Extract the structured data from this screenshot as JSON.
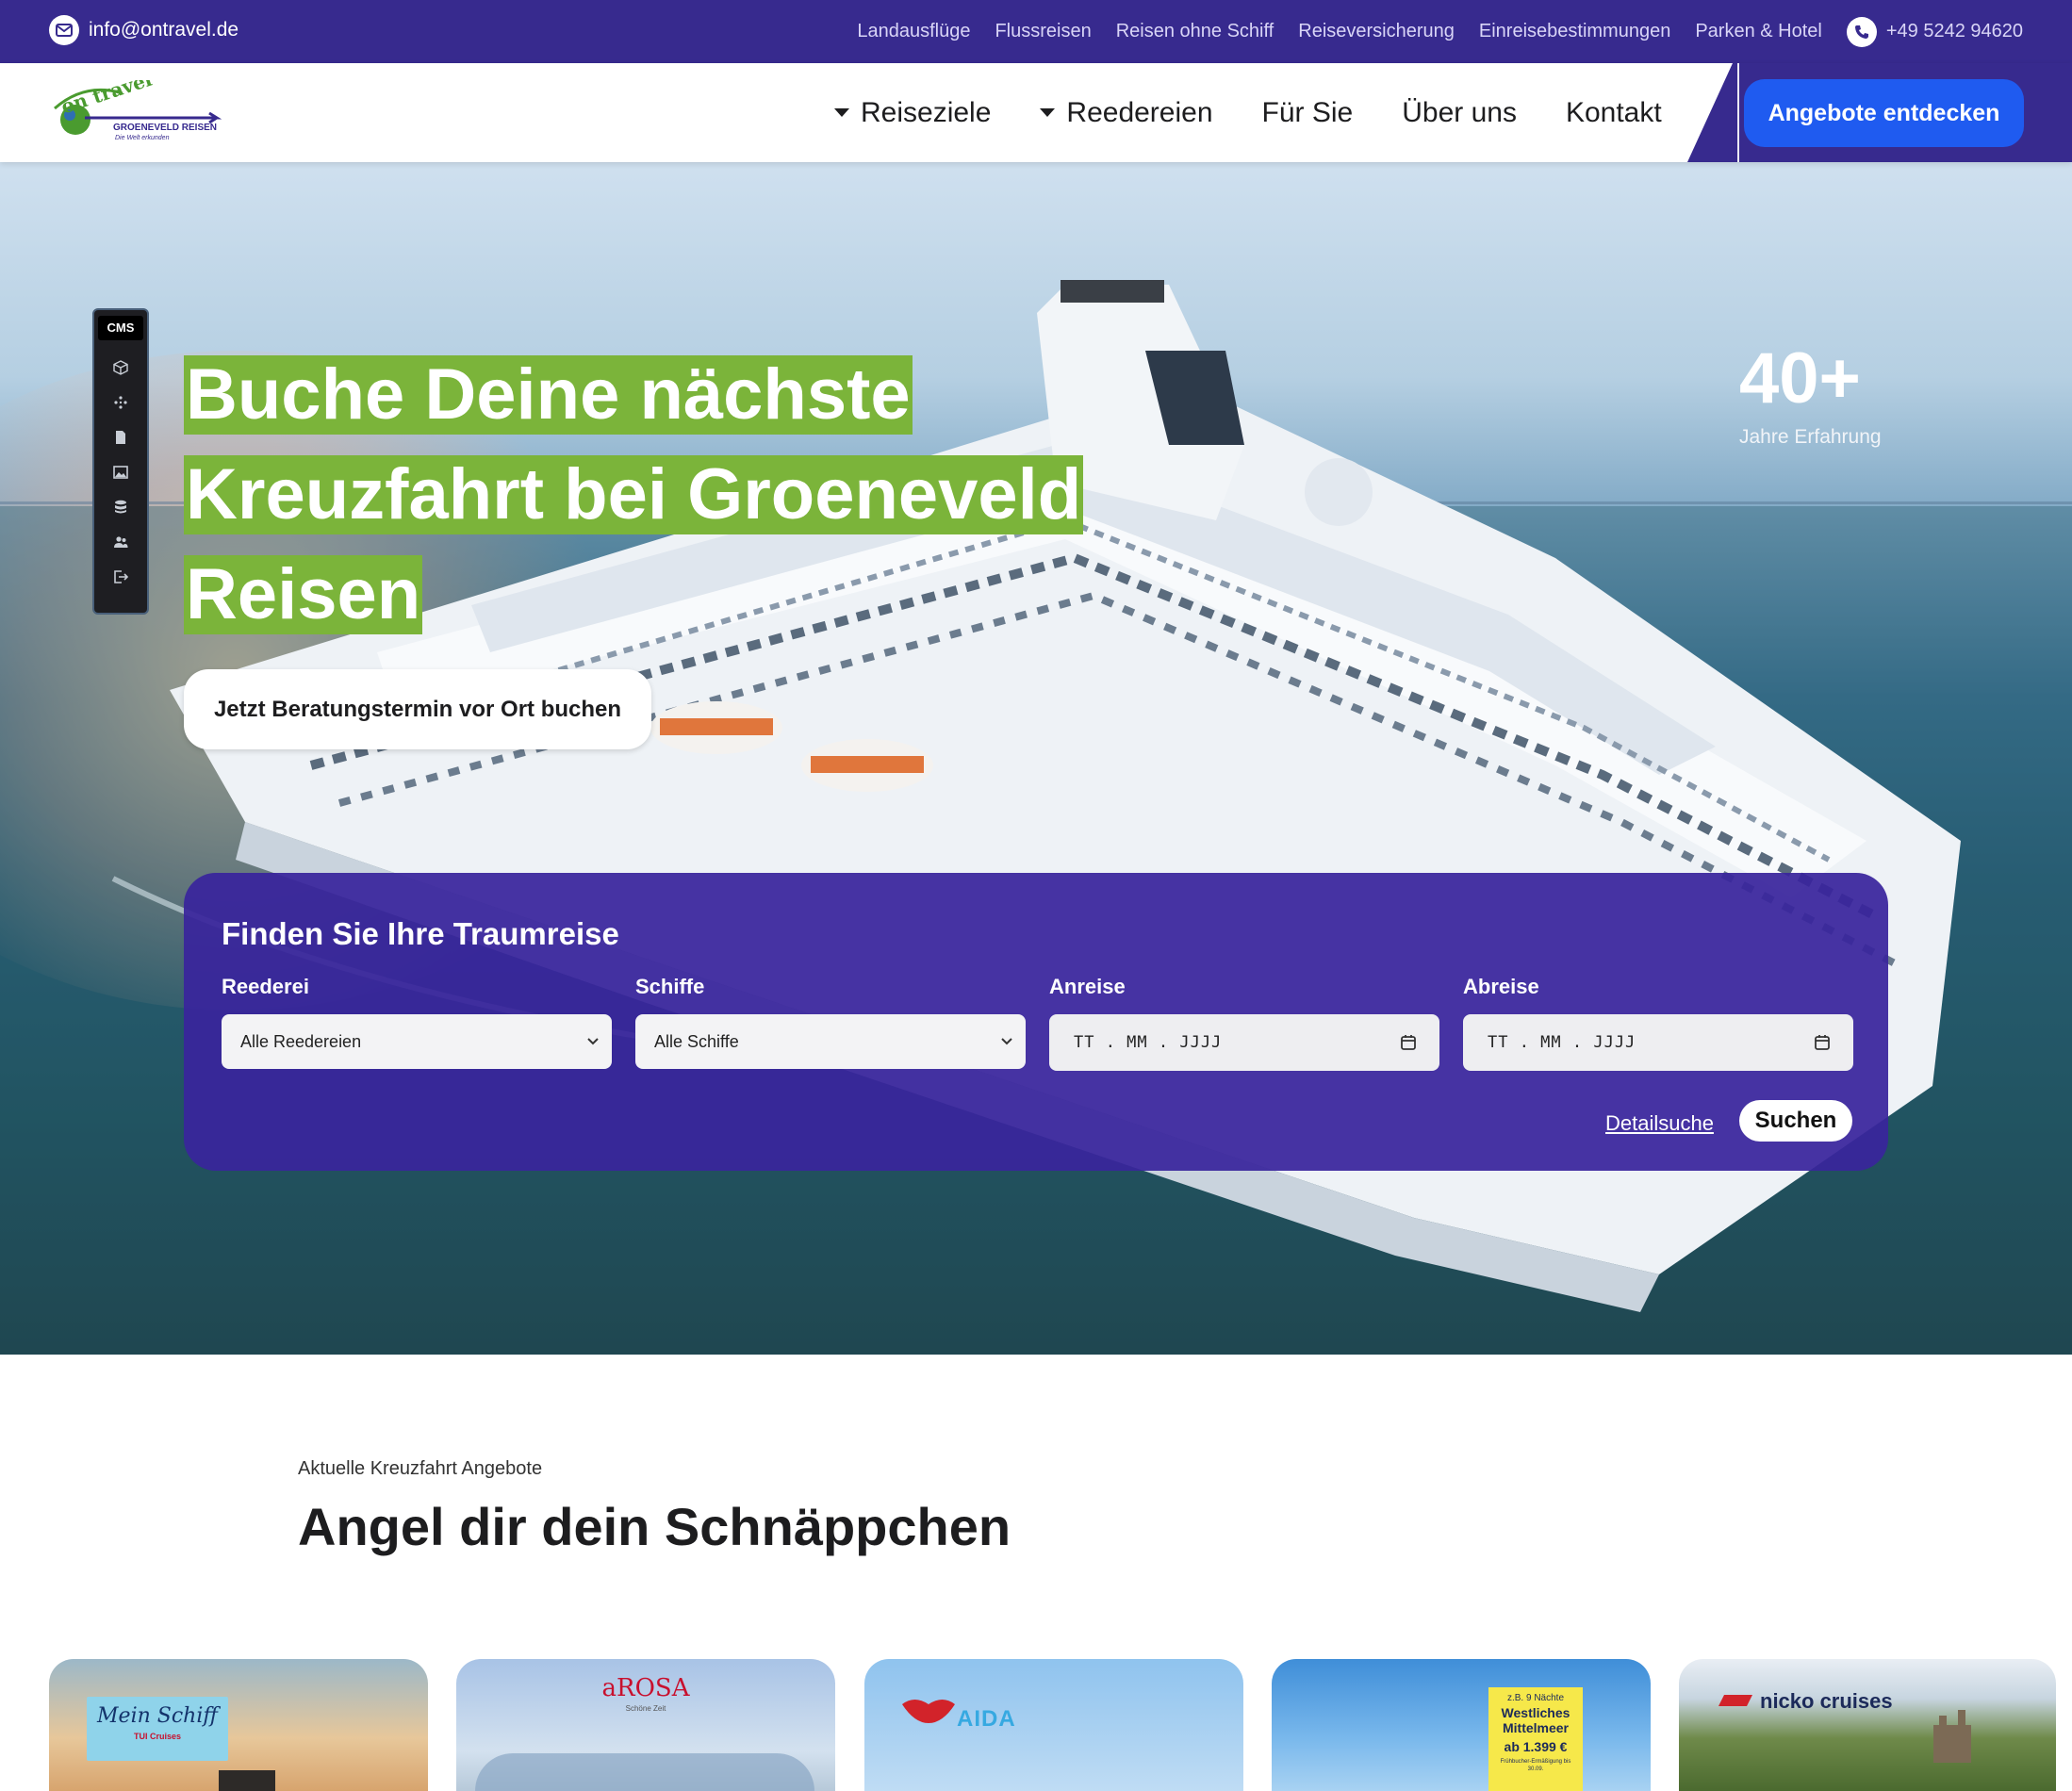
{
  "topbar": {
    "email": "info@ontravel.de",
    "links": [
      "Landausflüge",
      "Flussreisen",
      "Reisen ohne Schiff",
      "Reiseversicherung",
      "Einreisebestimmungen",
      "Parken & Hotel"
    ],
    "phone": "+49 5242 94620"
  },
  "logo": {
    "script_text": "on travel",
    "company": "GROENEVELD REISEN",
    "tagline": "Die Welt erkunden"
  },
  "nav": {
    "items": [
      "Reiseziele",
      "Reedereien",
      "Für Sie",
      "Über uns",
      "Kontakt"
    ],
    "cta": "Angebote entdecken"
  },
  "cms": {
    "label": "CMS",
    "icons": [
      "cube-icon",
      "sparkle-icon",
      "page-icon",
      "image-icon",
      "database-icon",
      "users-icon",
      "logout-icon"
    ]
  },
  "hero": {
    "headline_lines": [
      "Buche Deine nächste",
      "Kreuzfahrt bei Groeneveld",
      "Reisen"
    ],
    "button": "Jetzt Beratungstermin vor Ort buchen",
    "stat_number": "40+",
    "stat_label": "Jahre Erfahrung"
  },
  "finder": {
    "title": "Finden Sie Ihre Traumreise",
    "fields": [
      {
        "label": "Reederei",
        "value": "Alle Reedereien"
      },
      {
        "label": "Schiffe",
        "value": "Alle Schiffe"
      },
      {
        "label": "Anreise",
        "placeholder": "TT . MM . JJJJ"
      },
      {
        "label": "Abreise",
        "placeholder": "TT . MM . JJJJ"
      }
    ],
    "detail_link": "Detailsuche",
    "search_button": "Suchen"
  },
  "offers": {
    "kicker": "Aktuelle Kreuzfahrt Angebote",
    "title": "Angel dir dein Schnäppchen",
    "cards": [
      {
        "brand": "Mein Schiff",
        "sub": "TUI Cruises"
      },
      {
        "brand": "aROSA",
        "sub": "Schöne Zeit"
      },
      {
        "brand": "AIDA"
      },
      {
        "badge_top": "z.B. 9 Nächte",
        "badge_title": "Westliches Mittelmeer",
        "badge_price": "ab 1.399 €",
        "badge_note": "Frühbucher-Ermäßigung bis 30.09."
      },
      {
        "brand": "nicko cruises"
      }
    ]
  },
  "colors": {
    "primary": "#372a8e",
    "cta_blue": "#1f5bf0",
    "highlight_green": "#7bb43a",
    "finder_bg": "#39259c"
  }
}
